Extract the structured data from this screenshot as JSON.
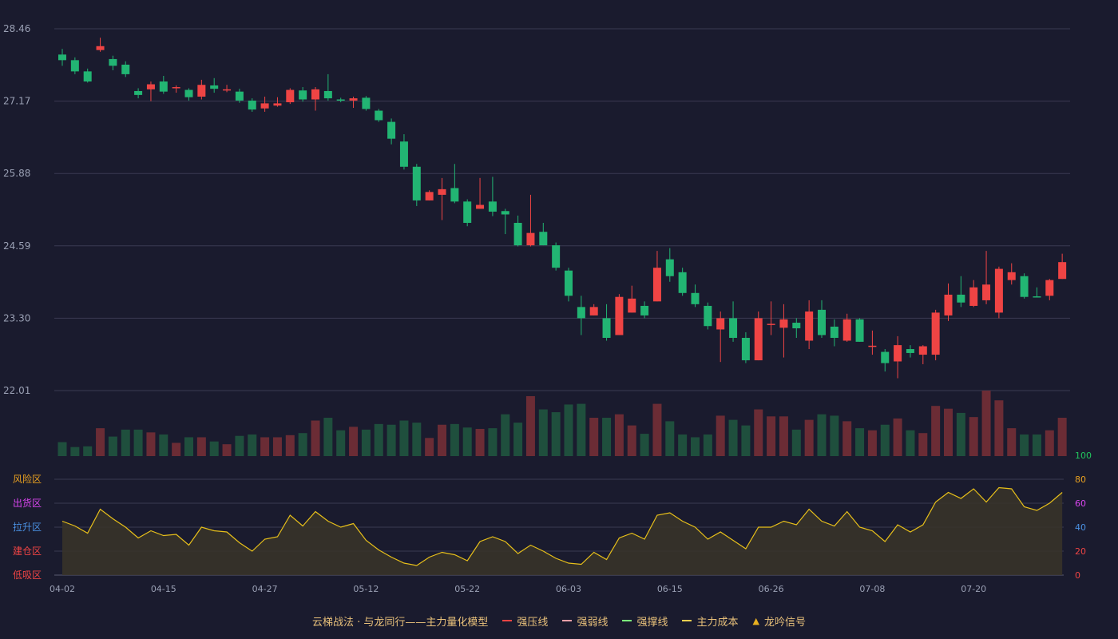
{
  "chart_data": {
    "type": "candlestick",
    "colors": {
      "up": "#ef4444",
      "down": "#22b573",
      "vol_up": "#6b2c35",
      "vol_down": "#1f4f3d",
      "grid": "#3a3b52",
      "axis_text": "#9aa0b4",
      "osc_line": "#e8c01a",
      "osc_fill": "#3a3428",
      "background": "#1a1b2e"
    },
    "x_ticks": [
      "04-02",
      "04-15",
      "04-27",
      "05-12",
      "05-22",
      "06-03",
      "06-15",
      "06-26",
      "07-08",
      "07-20"
    ],
    "x_tick_indices": [
      0,
      8,
      16,
      24,
      32,
      40,
      48,
      56,
      64,
      72
    ],
    "price_axis": {
      "ticks": [
        "28.46",
        "27.17",
        "25.88",
        "24.59",
        "23.30",
        "22.01"
      ],
      "min": 22.01,
      "max": 28.46
    },
    "osc_axis": {
      "ticks": [
        "0",
        "20",
        "40",
        "60",
        "80",
        "100"
      ],
      "tick_colors": [
        "#ef4444",
        "#ef4444",
        "#4a90e2",
        "#d946ef",
        "#e8a020",
        "#22c55e"
      ],
      "min": 0,
      "max": 100
    },
    "zones": [
      {
        "label": "风险区",
        "color": "#e8a020"
      },
      {
        "label": "出货区",
        "color": "#d946ef"
      },
      {
        "label": "拉升区",
        "color": "#4a90e2"
      },
      {
        "label": "建仓区",
        "color": "#ef4444"
      },
      {
        "label": "低吸区",
        "color": "#ef4444"
      }
    ],
    "candles": [
      [
        28.0,
        27.9,
        28.1,
        27.8
      ],
      [
        27.9,
        27.7,
        27.95,
        27.65
      ],
      [
        27.7,
        27.52,
        27.75,
        27.5
      ],
      [
        28.08,
        28.15,
        28.3,
        28.05
      ],
      [
        27.92,
        27.8,
        27.98,
        27.72
      ],
      [
        27.82,
        27.65,
        27.88,
        27.6
      ],
      [
        27.35,
        27.28,
        27.4,
        27.22
      ],
      [
        27.38,
        27.47,
        27.52,
        27.17
      ],
      [
        27.52,
        27.34,
        27.62,
        27.3
      ],
      [
        27.4,
        27.42,
        27.45,
        27.32
      ],
      [
        27.37,
        27.24,
        27.4,
        27.18
      ],
      [
        27.25,
        27.46,
        27.55,
        27.2
      ],
      [
        27.45,
        27.39,
        27.58,
        27.32
      ],
      [
        27.36,
        27.38,
        27.46,
        27.33
      ],
      [
        27.34,
        27.18,
        27.39,
        27.14
      ],
      [
        27.18,
        27.02,
        27.22,
        26.98
      ],
      [
        27.04,
        27.13,
        27.25,
        26.98
      ],
      [
        27.09,
        27.13,
        27.24,
        27.07
      ],
      [
        27.15,
        27.37,
        27.4,
        27.12
      ],
      [
        27.36,
        27.2,
        27.42,
        27.16
      ],
      [
        27.2,
        27.38,
        27.42,
        27.0
      ],
      [
        27.35,
        27.22,
        27.65,
        27.18
      ],
      [
        27.2,
        27.19,
        27.23,
        27.15
      ],
      [
        27.18,
        27.22,
        27.25,
        27.05
      ],
      [
        27.23,
        27.03,
        27.26,
        27.0
      ],
      [
        27.0,
        26.83,
        27.03,
        26.8
      ],
      [
        26.8,
        26.5,
        26.86,
        26.4
      ],
      [
        26.45,
        26.0,
        26.58,
        25.95
      ],
      [
        26.0,
        25.4,
        26.05,
        25.3
      ],
      [
        25.4,
        25.55,
        25.58,
        25.4
      ],
      [
        25.5,
        25.6,
        25.8,
        25.05
      ],
      [
        25.62,
        25.38,
        26.05,
        25.35
      ],
      [
        25.38,
        25.0,
        25.42,
        24.94
      ],
      [
        25.25,
        25.32,
        25.8,
        25.25
      ],
      [
        25.38,
        25.2,
        25.82,
        25.12
      ],
      [
        25.21,
        25.15,
        25.25,
        24.8
      ],
      [
        25.0,
        24.6,
        25.13,
        24.58
      ],
      [
        24.6,
        24.82,
        25.5,
        24.58
      ],
      [
        24.84,
        24.6,
        25.0,
        24.6
      ],
      [
        24.6,
        24.2,
        24.65,
        24.15
      ],
      [
        24.15,
        23.7,
        24.2,
        23.6
      ],
      [
        23.5,
        23.3,
        23.7,
        23.0
      ],
      [
        23.35,
        23.5,
        23.55,
        23.35
      ],
      [
        23.3,
        22.95,
        23.55,
        22.9
      ],
      [
        23.0,
        23.68,
        23.73,
        23.0
      ],
      [
        23.4,
        23.65,
        23.88,
        23.4
      ],
      [
        23.52,
        23.35,
        23.6,
        23.3
      ],
      [
        23.6,
        24.2,
        24.5,
        23.6
      ],
      [
        24.35,
        24.05,
        24.55,
        23.95
      ],
      [
        24.12,
        23.75,
        24.2,
        23.7
      ],
      [
        23.75,
        23.55,
        23.9,
        23.5
      ],
      [
        23.52,
        23.16,
        23.58,
        23.1
      ],
      [
        23.1,
        23.3,
        23.42,
        22.52
      ],
      [
        23.3,
        22.95,
        23.6,
        22.88
      ],
      [
        22.95,
        22.55,
        23.05,
        22.5
      ],
      [
        22.55,
        23.3,
        23.42,
        22.55
      ],
      [
        23.2,
        23.2,
        23.6,
        23.0
      ],
      [
        23.13,
        23.28,
        23.55,
        22.6
      ],
      [
        23.22,
        23.12,
        23.3,
        22.95
      ],
      [
        22.9,
        23.42,
        23.62,
        22.75
      ],
      [
        23.45,
        23.0,
        23.62,
        22.95
      ],
      [
        23.15,
        22.95,
        23.28,
        22.8
      ],
      [
        22.9,
        23.28,
        23.38,
        22.88
      ],
      [
        23.28,
        22.88,
        23.3,
        22.88
      ],
      [
        22.8,
        22.81,
        23.08,
        22.65
      ],
      [
        22.7,
        22.5,
        22.75,
        22.35
      ],
      [
        22.53,
        22.82,
        22.98,
        22.23
      ],
      [
        22.75,
        22.68,
        22.82,
        22.6
      ],
      [
        22.65,
        22.8,
        22.82,
        22.48
      ],
      [
        22.65,
        23.4,
        23.45,
        22.55
      ],
      [
        23.35,
        23.72,
        23.92,
        23.25
      ],
      [
        23.72,
        23.58,
        24.05,
        23.5
      ],
      [
        23.52,
        23.85,
        23.98,
        23.5
      ],
      [
        23.62,
        23.9,
        24.5,
        23.55
      ],
      [
        23.4,
        24.18,
        24.22,
        23.3
      ],
      [
        23.98,
        24.12,
        24.28,
        23.9
      ],
      [
        24.05,
        23.68,
        24.1,
        23.65
      ],
      [
        23.69,
        23.68,
        23.85,
        23.68
      ],
      [
        23.7,
        23.98,
        24.0,
        23.62
      ],
      [
        24.0,
        24.3,
        24.45,
        24.0
      ]
    ],
    "volume": [
      20,
      13,
      14,
      40,
      28,
      38,
      38,
      34,
      31,
      19,
      27,
      27,
      21,
      17,
      29,
      31,
      27,
      27,
      30,
      33,
      51,
      55,
      37,
      42,
      38,
      46,
      45,
      51,
      48,
      26,
      45,
      46,
      41,
      39,
      40,
      60,
      48,
      86,
      67,
      63,
      74,
      75,
      55,
      55,
      60,
      44,
      32,
      75,
      50,
      31,
      27,
      31,
      58,
      52,
      44,
      67,
      57,
      57,
      38,
      52,
      60,
      58,
      50,
      40,
      37,
      45,
      54,
      37,
      33,
      72,
      68,
      62,
      56,
      94,
      80,
      40,
      31,
      31,
      37,
      55
    ],
    "oscillator": [
      45,
      41,
      35,
      55,
      47,
      40,
      31,
      37,
      33,
      34,
      25,
      40,
      37,
      36,
      27,
      20,
      30,
      32,
      50,
      41,
      53,
      45,
      40,
      43,
      29,
      21,
      15,
      10,
      8,
      15,
      19,
      17,
      12,
      28,
      32,
      28,
      18,
      25,
      20,
      14,
      10,
      9,
      19,
      13,
      31,
      35,
      30,
      50,
      52,
      45,
      40,
      30,
      36,
      29,
      22,
      40,
      40,
      45,
      42,
      55,
      45,
      41,
      53,
      40,
      37,
      28,
      42,
      36,
      42,
      61,
      69,
      64,
      72,
      61,
      73,
      72,
      57,
      54,
      60,
      69
    ]
  },
  "legend": {
    "title": "云梯战法 · 与龙同行——主力量化模型",
    "items": [
      {
        "label": "强压线",
        "color": "#ef4444",
        "style": "solid"
      },
      {
        "label": "强弱线",
        "color": "#f0a0a8",
        "style": "dashed"
      },
      {
        "label": "强撑线",
        "color": "#7cfc7c",
        "style": "solid"
      },
      {
        "label": "主力成本",
        "color": "#f0d050",
        "style": "dashed"
      },
      {
        "label": "龙吟信号",
        "color": "#e8b020",
        "style": "triangle",
        "icon": "triangle-up-icon"
      }
    ]
  }
}
